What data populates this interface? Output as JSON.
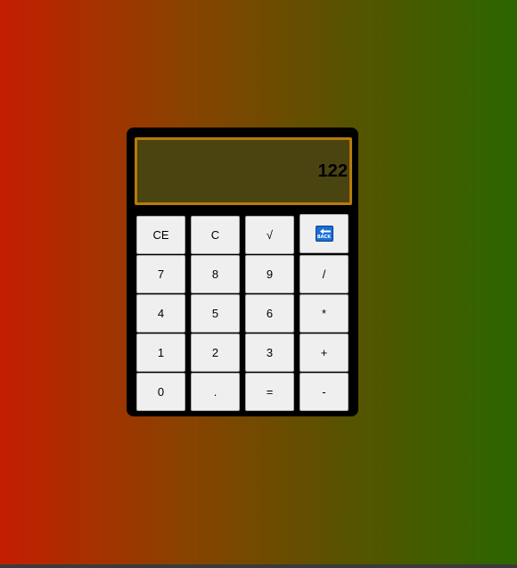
{
  "display": {
    "value": "122"
  },
  "buttons": {
    "ce": "CE",
    "c": "C",
    "sqrt": "√",
    "back_icon": "back-icon",
    "back_text": "BACK",
    "seven": "7",
    "eight": "8",
    "nine": "9",
    "divide": "/",
    "four": "4",
    "five": "5",
    "six": "6",
    "multiply": "*",
    "one": "1",
    "two": "2",
    "three": "3",
    "plus": "+",
    "zero": "0",
    "dot": ".",
    "equals": "=",
    "minus": "-"
  },
  "colors": {
    "gradient_start": "#c41e00",
    "gradient_end": "#2c6600",
    "calculator_body": "#000000",
    "display_bg": "#4a4410",
    "display_border": "#b87a0c",
    "button_bg": "#efefef",
    "back_icon": "#1a6fd6"
  }
}
